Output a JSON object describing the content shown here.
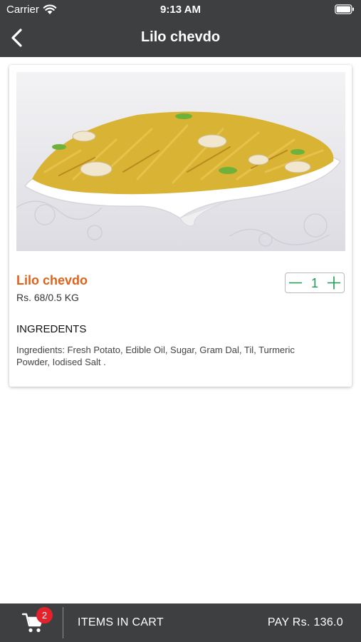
{
  "status_bar": {
    "carrier": "Carrier",
    "time": "9:13 AM",
    "icons": [
      "wifi-icon",
      "battery-icon"
    ]
  },
  "nav": {
    "title": "Lilo chevdo",
    "back_icon": "chevron-left-icon"
  },
  "product": {
    "name": "Lilo chevdo",
    "price": "Rs. 68/0.5 KG",
    "quantity": "1",
    "ingredients_heading": "INGREDENTS",
    "ingredients_text": "Ingredients: Fresh Potato, Edible Oil, Sugar, Gram Dal, Til, Turmeric Powder, Iodised Salt ."
  },
  "cart_bar": {
    "cart_count": "2",
    "items_label": "ITEMS IN CART",
    "pay_label": "PAY Rs. 136.0"
  },
  "colors": {
    "bar_background": "#3d3f41",
    "product_name": "#e0621a",
    "stepper_accent": "#1f9a52",
    "badge": "#e5212c"
  }
}
